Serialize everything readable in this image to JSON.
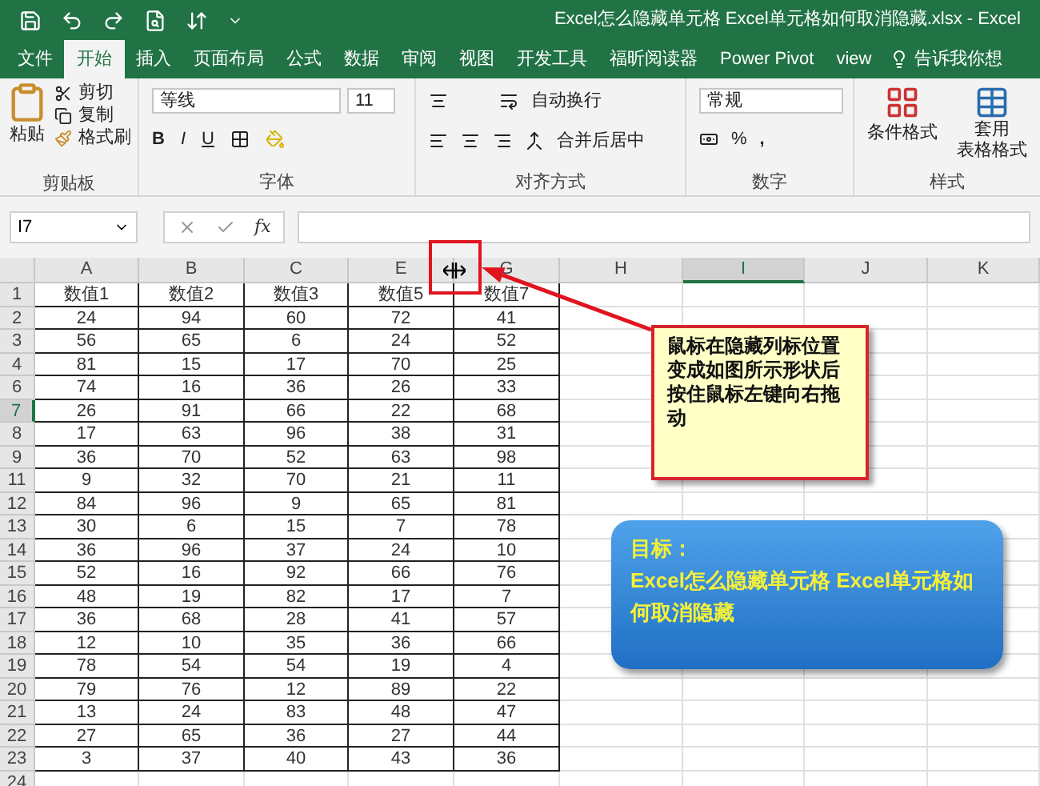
{
  "window": {
    "title": "Excel怎么隐藏单元格 Excel单元格如何取消隐藏.xlsx  -  Excel"
  },
  "tabs": [
    {
      "label": "文件",
      "selected": false
    },
    {
      "label": "开始",
      "selected": true
    },
    {
      "label": "插入",
      "selected": false
    },
    {
      "label": "页面布局",
      "selected": false
    },
    {
      "label": "公式",
      "selected": false
    },
    {
      "label": "数据",
      "selected": false
    },
    {
      "label": "审阅",
      "selected": false
    },
    {
      "label": "视图",
      "selected": false
    },
    {
      "label": "开发工具",
      "selected": false
    },
    {
      "label": "福昕阅读器",
      "selected": false
    },
    {
      "label": "Power Pivot",
      "selected": false
    },
    {
      "label": "view",
      "selected": false
    }
  ],
  "tell_me": "告诉我你想",
  "ribbon": {
    "clipboard": {
      "label": "剪贴板",
      "paste": "粘贴",
      "cut": "剪切",
      "copy": "复制",
      "format_painter": "格式刷"
    },
    "font": {
      "label": "字体",
      "font_name": "等线",
      "font_size": "11",
      "bold": "B",
      "italic": "I",
      "underline": "U"
    },
    "alignment": {
      "label": "对齐方式",
      "wrap": "自动换行",
      "merge": "合并后居中"
    },
    "number": {
      "label": "数字",
      "format": "常规",
      "percent": "%",
      "comma": ","
    },
    "styles": {
      "label": "样式",
      "conditional": "条件格式",
      "table_format": [
        "套用",
        "表格格式"
      ]
    }
  },
  "formula_bar": {
    "name_box": "I7",
    "fx": "fx"
  },
  "columns": [
    {
      "label": "A",
      "selected": false
    },
    {
      "label": "B",
      "selected": false
    },
    {
      "label": "C",
      "selected": false
    },
    {
      "label": "E",
      "selected": false
    },
    {
      "label": "G",
      "selected": false
    },
    {
      "label": "H",
      "selected": false
    },
    {
      "label": "I",
      "selected": true
    },
    {
      "label": "J",
      "selected": false
    },
    {
      "label": "K",
      "selected": false
    }
  ],
  "rows": [
    {
      "number": "1",
      "selected": false,
      "cells": [
        "数值1",
        "数值2",
        "数值3",
        "数值5",
        "数值7"
      ]
    },
    {
      "number": "2",
      "selected": false,
      "cells": [
        "24",
        "94",
        "60",
        "72",
        "41"
      ]
    },
    {
      "number": "3",
      "selected": false,
      "cells": [
        "56",
        "65",
        "6",
        "24",
        "52"
      ]
    },
    {
      "number": "4",
      "selected": false,
      "cells": [
        "81",
        "15",
        "17",
        "70",
        "25"
      ]
    },
    {
      "number": "6",
      "selected": false,
      "cells": [
        "74",
        "16",
        "36",
        "26",
        "33"
      ]
    },
    {
      "number": "7",
      "selected": true,
      "cells": [
        "26",
        "91",
        "66",
        "22",
        "68"
      ]
    },
    {
      "number": "8",
      "selected": false,
      "cells": [
        "17",
        "63",
        "96",
        "38",
        "31"
      ]
    },
    {
      "number": "9",
      "selected": false,
      "cells": [
        "36",
        "70",
        "52",
        "63",
        "98"
      ]
    },
    {
      "number": "11",
      "selected": false,
      "cells": [
        "9",
        "32",
        "70",
        "21",
        "11"
      ]
    },
    {
      "number": "12",
      "selected": false,
      "cells": [
        "84",
        "96",
        "9",
        "65",
        "81"
      ]
    },
    {
      "number": "13",
      "selected": false,
      "cells": [
        "30",
        "6",
        "15",
        "7",
        "78"
      ]
    },
    {
      "number": "14",
      "selected": false,
      "cells": [
        "36",
        "96",
        "37",
        "24",
        "10"
      ]
    },
    {
      "number": "15",
      "selected": false,
      "cells": [
        "52",
        "16",
        "92",
        "66",
        "76"
      ]
    },
    {
      "number": "16",
      "selected": false,
      "cells": [
        "48",
        "19",
        "82",
        "17",
        "7"
      ]
    },
    {
      "number": "17",
      "selected": false,
      "cells": [
        "36",
        "68",
        "28",
        "41",
        "57"
      ]
    },
    {
      "number": "18",
      "selected": false,
      "cells": [
        "12",
        "10",
        "35",
        "36",
        "66"
      ]
    },
    {
      "number": "19",
      "selected": false,
      "cells": [
        "78",
        "54",
        "54",
        "19",
        "4"
      ]
    },
    {
      "number": "20",
      "selected": false,
      "cells": [
        "79",
        "76",
        "12",
        "89",
        "22"
      ]
    },
    {
      "number": "21",
      "selected": false,
      "cells": [
        "13",
        "24",
        "83",
        "48",
        "47"
      ]
    },
    {
      "number": "22",
      "selected": false,
      "cells": [
        "27",
        "65",
        "36",
        "27",
        "44"
      ]
    },
    {
      "number": "23",
      "selected": false,
      "cells": [
        "3",
        "37",
        "40",
        "43",
        "36"
      ]
    },
    {
      "number": "24",
      "selected": false
    }
  ],
  "callout": {
    "text": "鼠标在隐藏列标位置变成如图所示形状后按住鼠标左键向右拖动"
  },
  "goal_box": {
    "title": "目标：",
    "text": "Excel怎么隐藏单元格 Excel单元格如何取消隐藏"
  }
}
